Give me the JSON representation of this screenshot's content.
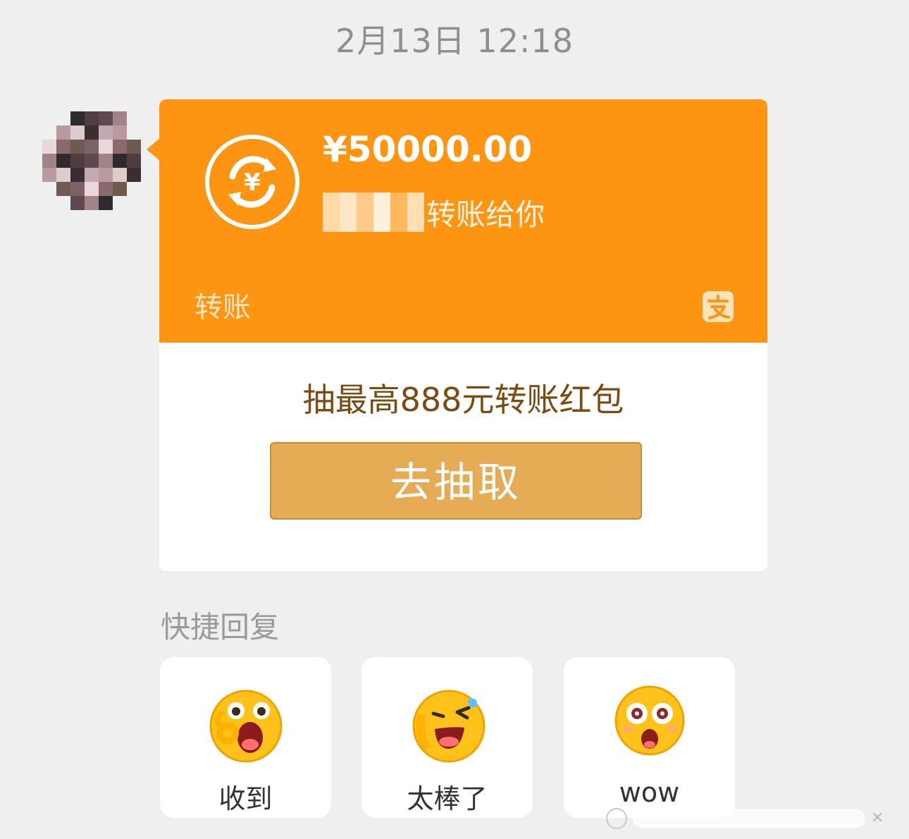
{
  "timestamp": "2月13日 12:18",
  "transfer": {
    "amount": "¥50000.00",
    "sender_suffix": "转账给你",
    "label": "转账",
    "promo_text": "抽最高888元转账红包",
    "button_label": "去抽取",
    "icon": "yuan-transfer-icon",
    "brand_icon": "alipay-icon",
    "color": "#fe9512"
  },
  "quick_reply": {
    "title": "快捷回复",
    "items": [
      {
        "label": "收到",
        "icon": "ok-hand-emoji-icon"
      },
      {
        "label": "太棒了",
        "icon": "laughing-emoji-icon"
      },
      {
        "label": "wow",
        "icon": "wow-face-emoji-icon"
      }
    ]
  }
}
